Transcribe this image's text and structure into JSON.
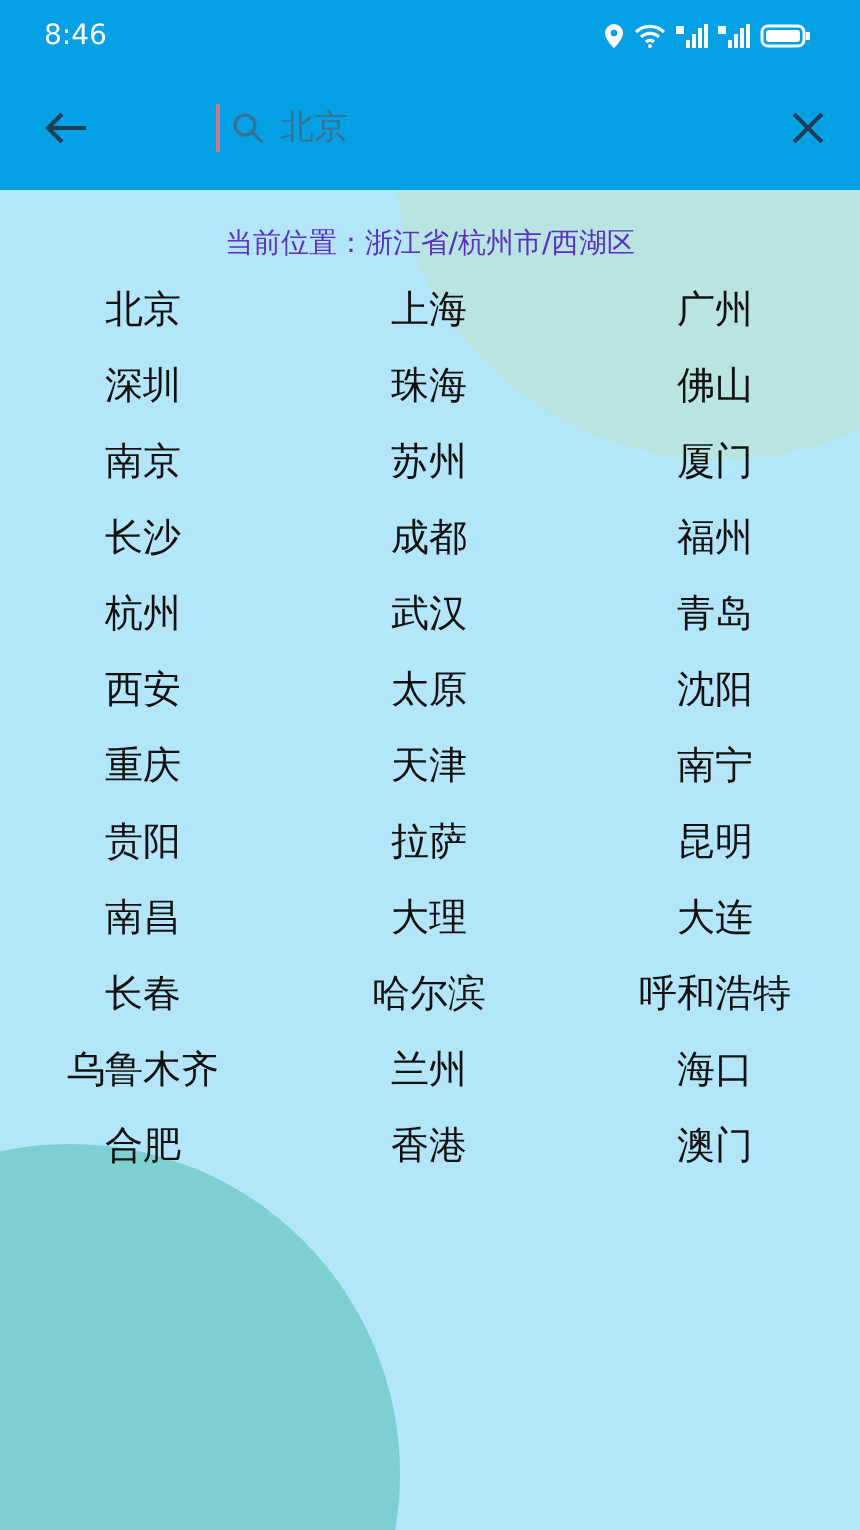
{
  "status_bar": {
    "time": "8:46"
  },
  "search": {
    "placeholder": "北京"
  },
  "location": "当前位置：浙江省/杭州市/西湖区",
  "cities": [
    "北京",
    "上海",
    "广州",
    "深圳",
    "珠海",
    "佛山",
    "南京",
    "苏州",
    "厦门",
    "长沙",
    "成都",
    "福州",
    "杭州",
    "武汉",
    "青岛",
    "西安",
    "太原",
    "沈阳",
    "重庆",
    "天津",
    "南宁",
    "贵阳",
    "拉萨",
    "昆明",
    "南昌",
    "大理",
    "大连",
    "长春",
    "哈尔滨",
    "呼和浩特",
    "乌鲁木齐",
    "兰州",
    "海口",
    "合肥",
    "香港",
    "澳门"
  ]
}
